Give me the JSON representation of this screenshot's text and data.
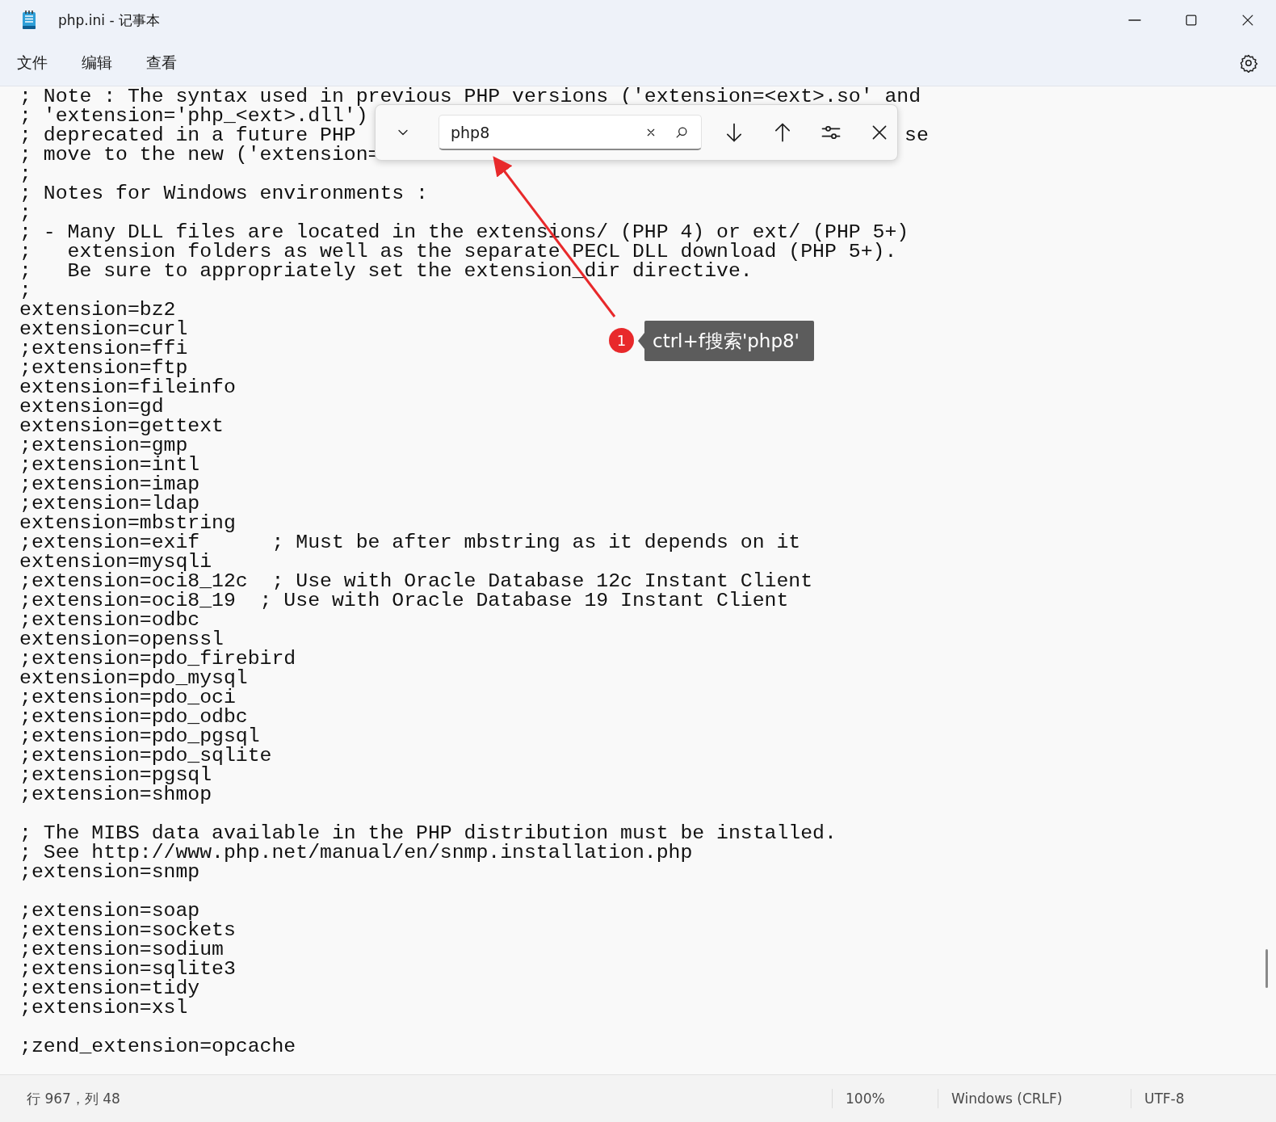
{
  "window": {
    "title": "php.ini - 记事本"
  },
  "menu": [
    "文件",
    "编辑",
    "查看"
  ],
  "editor": {
    "blocks": [
      [
        {
          "text": "; Note : The syntax used in previous PHP versions ('extension=<ext>.so' and"
        },
        {
          "text": "; 'extension='php_<ext>.dll')"
        },
        {
          "text": "; deprecated in a future PHP",
          "tail": "se"
        },
        {
          "text": "; move to the new ('extension="
        },
        {
          "text": ";"
        },
        {
          "text": "; Notes for Windows environments :"
        },
        {
          "text": ";"
        },
        {
          "text": "; - Many DLL files are located in the extensions/ (PHP 4) or ext/ (PHP 5+)"
        },
        {
          "text": ";   extension folders as well as the separate PECL DLL download (PHP 5+)."
        },
        {
          "text": ";   Be sure to appropriately set the extension_dir directive."
        },
        {
          "text": ";"
        },
        {
          "text": "extension=bz2"
        },
        {
          "text": "extension=curl"
        },
        {
          "text": ";extension=ffi"
        },
        {
          "text": ";extension=ftp"
        },
        {
          "text": "extension=fileinfo"
        },
        {
          "text": "extension=gd"
        },
        {
          "text": "extension=gettext"
        },
        {
          "text": ";extension=gmp"
        },
        {
          "text": ";extension=intl"
        },
        {
          "text": ";extension=imap"
        },
        {
          "text": ";extension=ldap"
        },
        {
          "text": "extension=mbstring"
        },
        {
          "text": ";extension=exif      ; Must be after mbstring as it depends on it"
        },
        {
          "text": "extension=mysqli"
        },
        {
          "text": ";extension=oci8_12c  ; Use with Oracle Database 12c Instant Client"
        },
        {
          "text": ";extension=oci8_19  ; Use with Oracle Database 19 Instant Client"
        },
        {
          "text": ";extension=odbc"
        },
        {
          "text": "extension=openssl"
        },
        {
          "text": ";extension=pdo_firebird"
        },
        {
          "text": "extension=pdo_mysql"
        },
        {
          "text": ";extension=pdo_oci"
        },
        {
          "text": ";extension=pdo_odbc"
        },
        {
          "text": ";extension=pdo_pgsql"
        },
        {
          "text": ";extension=pdo_sqlite"
        },
        {
          "text": ";extension=pgsql"
        },
        {
          "text": ";extension=shmop"
        }
      ],
      [
        {
          "text": "; The MIBS data available in the PHP distribution must be installed."
        },
        {
          "text": "; See http://www.php.net/manual/en/snmp.installation.php"
        },
        {
          "text": ";extension=snmp"
        }
      ],
      [
        {
          "text": ";extension=soap"
        },
        {
          "text": ";extension=sockets"
        },
        {
          "text": ";extension=sodium"
        },
        {
          "text": ";extension=sqlite3"
        },
        {
          "text": ";extension=tidy"
        },
        {
          "text": ";extension=xsl"
        }
      ],
      [
        {
          "text": ";zend_extension=opcache"
        }
      ]
    ]
  },
  "find_bar": {
    "value": "php8"
  },
  "annotation": {
    "badge": "1",
    "callout": "ctrl+f搜索'php8'"
  },
  "status_bar": {
    "position": "行 967，列 48",
    "zoom": "100%",
    "line_ending": "Windows (CRLF)",
    "encoding": "UTF-8"
  }
}
